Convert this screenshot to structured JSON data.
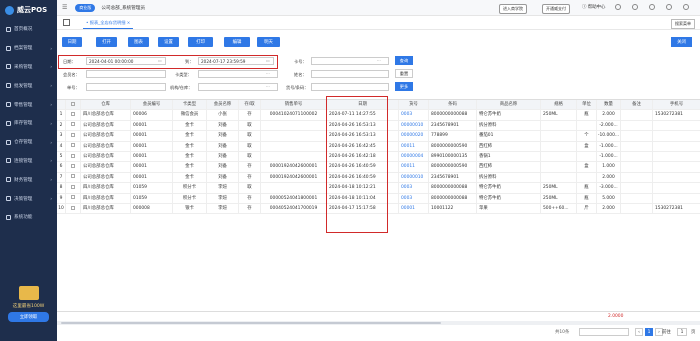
{
  "brand": {
    "name": "威云POS"
  },
  "sidebar": {
    "items": [
      {
        "label": "首页概况",
        "icon": "home-icon"
      },
      {
        "label": "档案管理",
        "icon": "archive-icon"
      },
      {
        "label": "采购管理",
        "icon": "cart-icon"
      },
      {
        "label": "批发管理",
        "icon": "box-icon"
      },
      {
        "label": "零售管理",
        "icon": "shop-icon"
      },
      {
        "label": "库存管理",
        "icon": "warehouse-icon"
      },
      {
        "label": "仓存管理",
        "icon": "stock-icon"
      },
      {
        "label": "连锁管理",
        "icon": "chain-icon"
      },
      {
        "label": "财务管理",
        "icon": "wallet-icon"
      },
      {
        "label": "决策管理",
        "icon": "chart-icon"
      },
      {
        "label": "系统功能",
        "icon": "gear-icon"
      }
    ],
    "promo_text": "这里最省100W",
    "promo_button": "立即领取"
  },
  "topbar": {
    "store": "商业版",
    "company": "公司总部_系统管理员",
    "btn1": "进入商学院",
    "btn2": "开通威支付",
    "help": "帮助中心"
  },
  "tabs": {
    "active": "• 报表_全店存货明细 ×",
    "search_menu": "搜索菜单"
  },
  "toolbar": {
    "buttons": [
      "日期",
      "打开",
      "图表",
      "设置",
      "打印",
      "编辑",
      "明天"
    ],
    "close": "关闭"
  },
  "form": {
    "date_label": "日期：",
    "date_from": "2024-04-01 00:00:00",
    "to_label": "到：",
    "date_to": "2024-07-17 23:59:59",
    "card_label": "卡号：",
    "query": "查询",
    "member_label": "会员名：",
    "card_type_label": "卡类型：",
    "name_label": "姓名：",
    "reset": "重置",
    "order_label": "单号：",
    "org_label": "机构/仓库：",
    "goods_label": "货号/条码：",
    "more": "更多"
  },
  "table": {
    "headers": [
      "",
      "",
      "仓库",
      "会员编号",
      "卡类型",
      "会员名称",
      "存/取",
      "销售单号",
      "日期",
      "货号",
      "条码",
      "商品名称",
      "规格",
      "单位",
      "数量",
      "备注",
      "手机号"
    ],
    "rows": [
      [
        "1",
        "四川总部总仓库",
        "00006",
        "微信会员",
        "小张",
        "存",
        "00041024071100002",
        "2024-07-11 14:27:55",
        "0003",
        "8000000000088",
        "特仑苏牛奶",
        "250ML",
        "瓶",
        "2.000",
        "",
        "1530272381"
      ],
      [
        "2",
        "公司总部总仓库",
        "00001",
        "金卡",
        "刘备",
        "取",
        "",
        "2024-04-26 16:53:13",
        "00000010",
        "2345678901",
        "拆分原料",
        "",
        "",
        "-2.000...",
        "",
        ""
      ],
      [
        "3",
        "公司总部总仓库",
        "00001",
        "金卡",
        "刘备",
        "取",
        "",
        "2024-04-26 16:53:13",
        "00000020",
        "778899",
        "番茄01",
        "",
        "个",
        "-10.000...",
        "",
        ""
      ],
      [
        "4",
        "公司总部总仓库",
        "00001",
        "金卡",
        "刘备",
        "取",
        "",
        "2024-04-26 16:42:45",
        "00011",
        "8000000000590",
        "西红柿",
        "",
        "盒",
        "-1.000...",
        "",
        ""
      ],
      [
        "5",
        "公司总部总仓库",
        "00001",
        "金卡",
        "刘备",
        "取",
        "",
        "2024-04-26 16:42:18",
        "00000004",
        "8990100000135",
        "香锅1",
        "",
        "",
        "-1.000...",
        "",
        ""
      ],
      [
        "6",
        "公司总部总仓库",
        "00001",
        "金卡",
        "刘备",
        "存",
        "00001924042600001",
        "2024-04-26 16:40:59",
        "00011",
        "8000000000590",
        "西红柿",
        "",
        "盒",
        "1.000",
        "",
        ""
      ],
      [
        "7",
        "公司总部总仓库",
        "00001",
        "金卡",
        "刘备",
        "存",
        "00001924042600001",
        "2024-04-26 16:40:59",
        "00000010",
        "2345678901",
        "拆分原料",
        "",
        "",
        "2.000",
        "",
        ""
      ],
      [
        "8",
        "四川总部总仓库",
        "01059",
        "积分卡",
        "李煊",
        "取",
        "",
        "2024-04-18 10:12:21",
        "0003",
        "8000000000088",
        "特仑苏牛奶",
        "250ML",
        "瓶",
        "-3.000...",
        "",
        ""
      ],
      [
        "9",
        "四川总部总仓库",
        "01059",
        "积分卡",
        "李煊",
        "存",
        "00000524041800001",
        "2024-04-18 10:11:04",
        "0003",
        "8000000000088",
        "特仑苏牛奶",
        "250ML",
        "瓶",
        "5.000",
        "",
        ""
      ],
      [
        "10",
        "四川总部总仓库",
        "000008",
        "银卡",
        "李煊",
        "存",
        "00040524041700019",
        "2024-04-17 15:17:58",
        "00001",
        "10001122",
        "苹果",
        "500++60...",
        "斤",
        "2.000",
        "",
        "1530272381"
      ]
    ],
    "total": "2.0000"
  },
  "pager": {
    "total": "共10条",
    "page": "1",
    "goto_label": "前往",
    "goto_value": "1",
    "page_label": "页"
  }
}
